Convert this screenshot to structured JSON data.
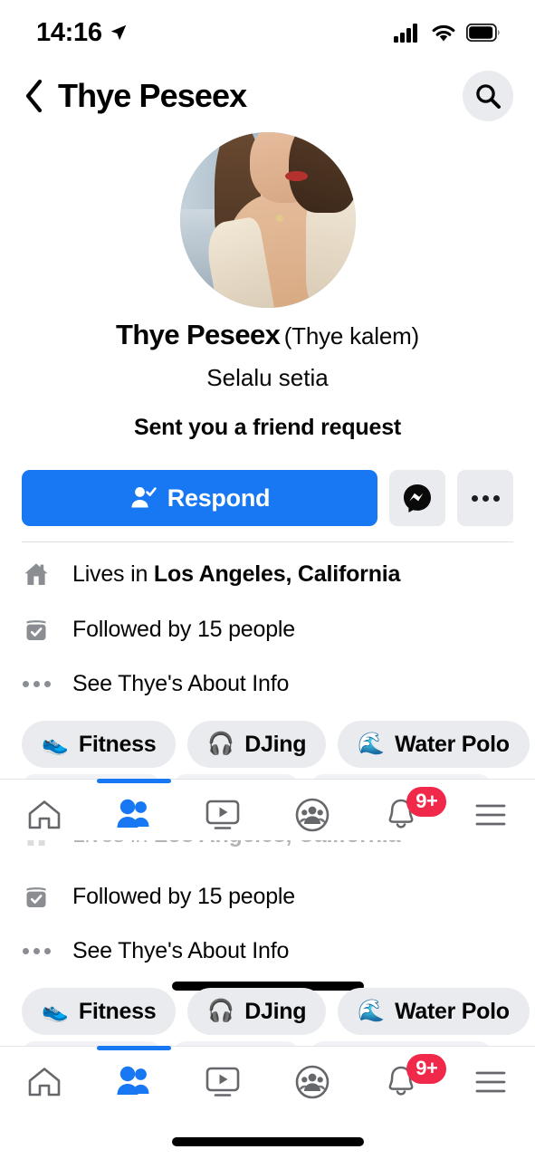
{
  "status_bar": {
    "time": "14:16",
    "location_icon": "location-arrow-icon",
    "cellular_icon": "cellular-bars-icon",
    "wifi_icon": "wifi-icon",
    "battery_icon": "battery-icon"
  },
  "header": {
    "back_icon": "chevron-left-icon",
    "title": "Thye Peseex",
    "search_icon": "search-icon"
  },
  "profile": {
    "avatar_name": "profile-avatar",
    "name": "Thye Peseex",
    "alias": "(Thye kalem)",
    "bio": "Selalu setia",
    "status": "Sent you a friend request"
  },
  "actions": {
    "respond_label": "Respond",
    "respond_icon": "person-check-icon",
    "respond_color": "#1877f2",
    "messenger_icon": "messenger-icon",
    "more_icon": "ellipsis-icon"
  },
  "info_rows": [
    {
      "icon": "home-icon",
      "prefix": "Lives in ",
      "bold": "Los Angeles, California"
    },
    {
      "icon": "followers-check-icon",
      "prefix": "Followed by 15 people",
      "bold": ""
    },
    {
      "icon": "ellipsis-icon",
      "prefix": "See Thye's About Info",
      "bold": ""
    }
  ],
  "chips": [
    {
      "emoji": "👟",
      "label": "Fitness",
      "icon": "sneaker-icon"
    },
    {
      "emoji": "🎧",
      "label": "DJing",
      "icon": "headphones-icon"
    },
    {
      "emoji": "🌊",
      "label": "Water Polo",
      "icon": "wave-icon"
    }
  ],
  "bottom_nav": {
    "active_index": 1,
    "accent_color": "#1877f2",
    "badge_color": "#f02849",
    "items": [
      {
        "icon": "home-outline-icon",
        "label": "Home",
        "badge": ""
      },
      {
        "icon": "friends-icon",
        "label": "Friends",
        "badge": ""
      },
      {
        "icon": "video-icon",
        "label": "Video",
        "badge": ""
      },
      {
        "icon": "groups-icon",
        "label": "Groups",
        "badge": ""
      },
      {
        "icon": "bell-icon",
        "label": "Notifications",
        "badge": "9+"
      },
      {
        "icon": "menu-hamburger-icon",
        "label": "Menu",
        "badge": ""
      }
    ]
  },
  "home_indicator": "home-indicator"
}
